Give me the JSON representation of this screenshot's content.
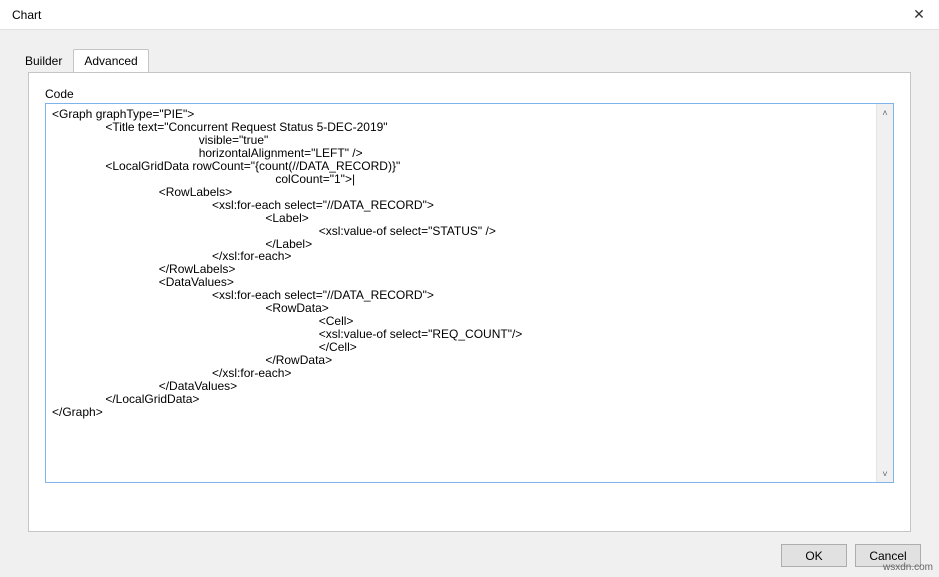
{
  "titlebar": {
    "title": "Chart"
  },
  "tabs": {
    "builder": "Builder",
    "advanced": "Advanced"
  },
  "panel": {
    "code_label": "Code",
    "code": "<Graph graphType=\"PIE\">\n                <Title text=\"Concurrent Request Status 5-DEC-2019\"\n                                            visible=\"true\"\n                                            horizontalAlignment=\"LEFT\" />\n                <LocalGridData rowCount=\"{count(//DATA_RECORD)}\"\n                                                                   colCount=\"1\">|\n                                <RowLabels>\n                                                <xsl:for-each select=\"//DATA_RECORD\">\n                                                                <Label>\n                                                                                <xsl:value-of select=\"STATUS\" />\n                                                                </Label>\n                                                </xsl:for-each>\n                                </RowLabels>\n                                <DataValues>\n                                                <xsl:for-each select=\"//DATA_RECORD\">\n                                                                <RowData>\n                                                                                <Cell>\n                                                                                <xsl:value-of select=\"REQ_COUNT\"/>\n                                                                                </Cell>\n                                                                </RowData>\n                                                </xsl:for-each>\n                                </DataValues>\n                </LocalGridData>\n</Graph>"
  },
  "buttons": {
    "ok": "OK",
    "cancel": "Cancel"
  },
  "watermark": "wsxdn.com"
}
